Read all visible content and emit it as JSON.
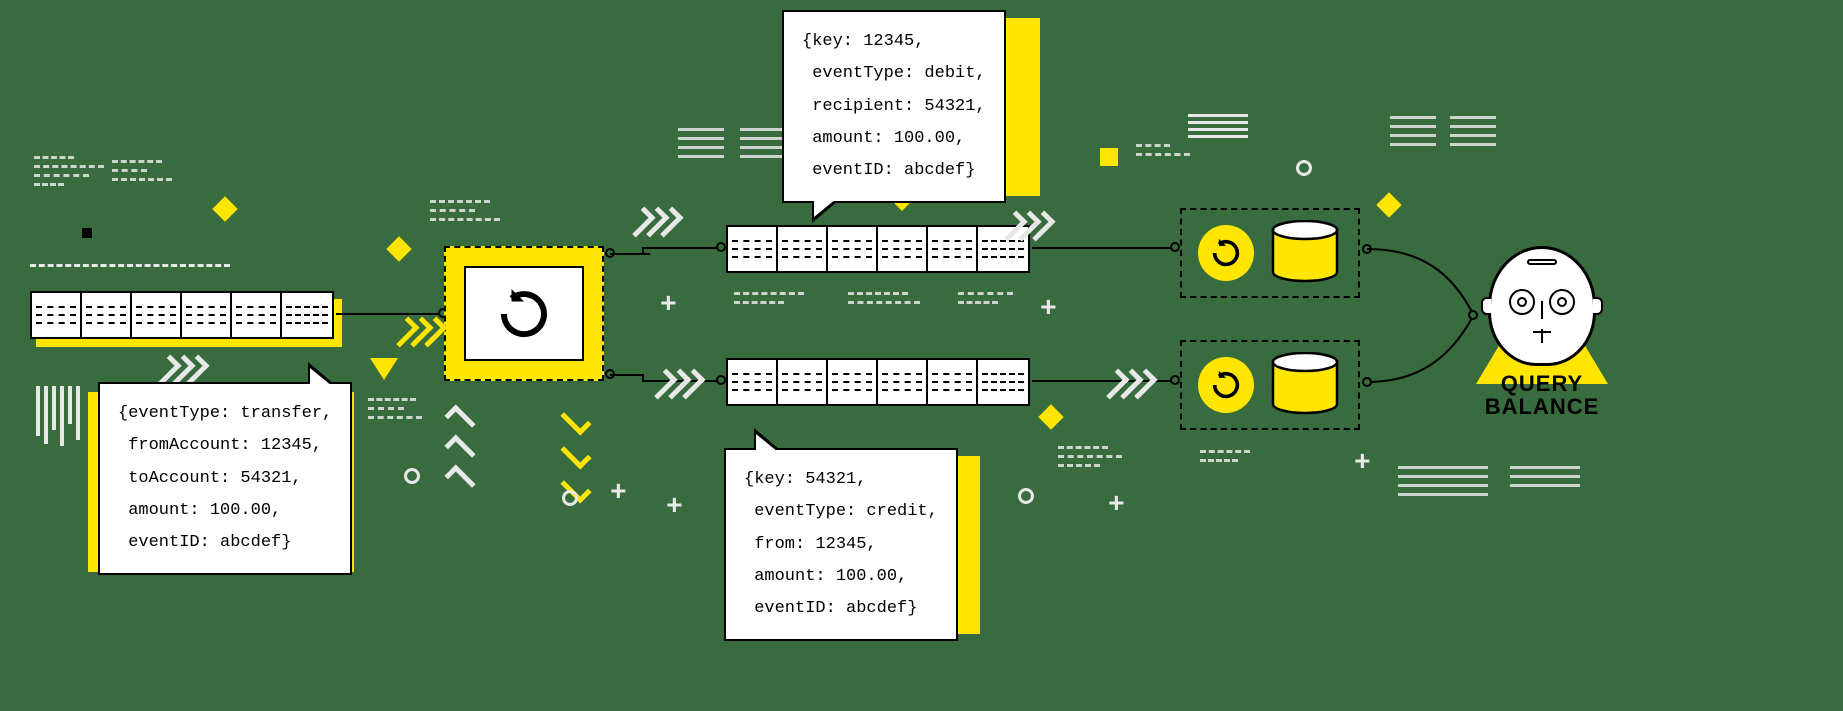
{
  "bubbles": {
    "input": "{eventType: transfer,\n fromAccount: 12345,\n toAccount: 54321,\n amount: 100.00,\n eventID: abcdef}",
    "debit": "{key: 12345,\n eventType: debit,\n recipient: 54321,\n amount: 100.00,\n eventID: abcdef}",
    "credit": "{key: 54321,\n eventType: credit,\n from: 12345,\n amount: 100.00,\n eventID: abcdef}"
  },
  "robot": {
    "label_line1": "QUERY",
    "label_line2": "BALANCE"
  },
  "colors": {
    "accent": "#ffe500",
    "bg": "#386c3e"
  }
}
